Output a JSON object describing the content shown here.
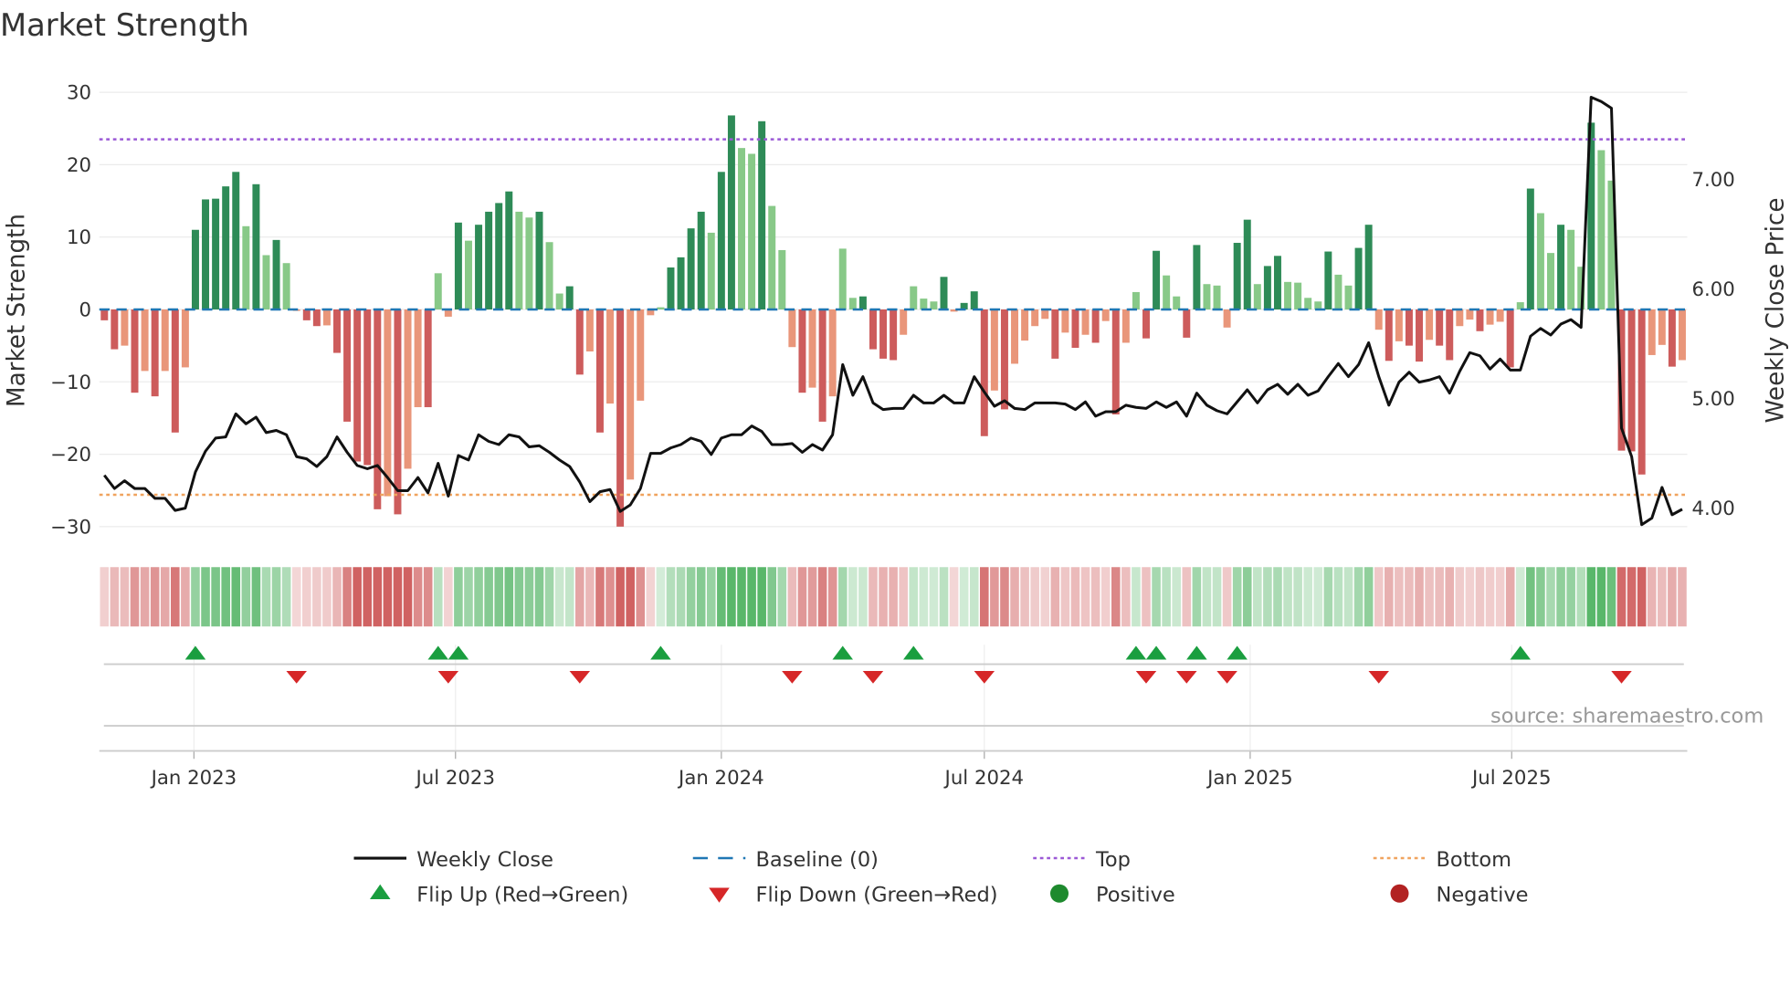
{
  "chart_data": {
    "type": "bar",
    "title": "Market Strength",
    "ylabel": "Market Strength",
    "y2label": "Weekly Close Price",
    "ylim": [
      -32.6,
      32.5
    ],
    "y2lim": [
      3.66,
      7.96
    ],
    "yticks": [
      30,
      20,
      10,
      0,
      -10,
      -20,
      -30
    ],
    "ytick_labels": [
      "30",
      "20",
      "10",
      "0",
      "−10",
      "−20",
      "−30"
    ],
    "y2ticks": [
      7,
      6,
      5,
      4
    ],
    "y2tick_labels": [
      "7.00",
      "6.00",
      "5.00",
      "4.00"
    ],
    "x_start_week": "2022-10-31",
    "xticks": [
      {
        "date": "2023-01-01",
        "label": "Jan 2023"
      },
      {
        "date": "2023-07-01",
        "label": "Jul 2023"
      },
      {
        "date": "2024-01-01",
        "label": "Jan 2024"
      },
      {
        "date": "2024-07-01",
        "label": "Jul 2024"
      },
      {
        "date": "2025-01-01",
        "label": "Jan 2025"
      },
      {
        "date": "2025-07-01",
        "label": "Jul 2025"
      }
    ],
    "top_level": 23.5,
    "bottom_level": -25.6,
    "baseline": 0,
    "strength": [
      -1.5,
      -5.5,
      -5,
      -11.5,
      -8.5,
      -12,
      -8.5,
      -17,
      -8,
      11,
      15.2,
      15.3,
      17,
      19,
      11.5,
      17.3,
      7.5,
      9.6,
      6.4,
      -0.2,
      -1.5,
      -2.3,
      -2.2,
      -6,
      -15.5,
      -21,
      -21.5,
      -27.6,
      -25.8,
      -28.3,
      -22,
      -13.5,
      -13.5,
      5,
      -1,
      12,
      9.5,
      11.7,
      13.5,
      14.7,
      16.3,
      13.5,
      12.7,
      13.5,
      9.3,
      2.2,
      3.2,
      -9,
      -5.8,
      -17,
      -13,
      -30,
      -23.5,
      -12.6,
      -0.8,
      0.3,
      5.8,
      7.2,
      11.2,
      13.5,
      10.6,
      19,
      26.8,
      22.3,
      21.5,
      26,
      14.3,
      8.2,
      -5.2,
      -11.5,
      -10.8,
      -15.5,
      -12,
      8.4,
      1.6,
      1.8,
      -5.5,
      -6.8,
      -7,
      -3.5,
      3.2,
      1.5,
      1.1,
      4.5,
      -0.3,
      0.9,
      2.5,
      -17.5,
      -11.2,
      -13.8,
      -7.5,
      -4.3,
      -2.3,
      -1.3,
      -6.8,
      -3.2,
      -5.3,
      -3.5,
      -4.6,
      -1.6,
      -14.5,
      -4.6,
      2.4,
      -4,
      8.1,
      4.7,
      1.8,
      -3.9,
      8.9,
      3.5,
      3.3,
      -2.5,
      9.2,
      12.4,
      3.5,
      6,
      7.4,
      3.8,
      3.7,
      1.6,
      1.1,
      8,
      4.8,
      3.3,
      8.5,
      11.7,
      -2.8,
      -7.1,
      -4.4,
      -5,
      -7.2,
      -4.2,
      -5,
      -7,
      -2.3,
      -1.4,
      -3,
      -2.1,
      -1.7,
      -8,
      1,
      16.7,
      13.3,
      7.8,
      11.7,
      11,
      5.9,
      25.8,
      22,
      17.8,
      -19.5,
      -19.6,
      -22.8,
      -6.3,
      -4.9,
      -7.9,
      -7
    ],
    "weekly_close": [
      4.3,
      4.18,
      4.25,
      4.18,
      4.18,
      4.09,
      4.09,
      3.98,
      4.0,
      4.33,
      4.52,
      4.64,
      4.65,
      4.86,
      4.77,
      4.83,
      4.69,
      4.71,
      4.67,
      4.47,
      4.45,
      4.38,
      4.47,
      4.65,
      4.51,
      4.39,
      4.36,
      4.39,
      4.28,
      4.16,
      4.16,
      4.28,
      4.14,
      4.41,
      4.11,
      4.48,
      4.44,
      4.67,
      4.61,
      4.58,
      4.67,
      4.65,
      4.56,
      4.57,
      4.51,
      4.44,
      4.38,
      4.24,
      4.06,
      4.15,
      4.17,
      3.97,
      4.03,
      4.18,
      4.5,
      4.5,
      4.55,
      4.58,
      4.64,
      4.61,
      4.49,
      4.64,
      4.67,
      4.67,
      4.75,
      4.7,
      4.58,
      4.58,
      4.59,
      4.51,
      4.58,
      4.53,
      4.67,
      5.31,
      5.03,
      5.2,
      4.96,
      4.9,
      4.91,
      4.91,
      5.03,
      4.96,
      4.96,
      5.03,
      4.96,
      4.96,
      5.2,
      5.06,
      4.93,
      4.98,
      4.91,
      4.9,
      4.96,
      4.96,
      4.96,
      4.95,
      4.9,
      4.97,
      4.84,
      4.88,
      4.88,
      4.94,
      4.92,
      4.91,
      4.97,
      4.92,
      4.97,
      4.84,
      5.05,
      4.94,
      4.89,
      4.86,
      4.97,
      5.08,
      4.96,
      5.08,
      5.13,
      5.04,
      5.13,
      5.03,
      5.07,
      5.2,
      5.32,
      5.2,
      5.31,
      5.51,
      5.2,
      4.94,
      5.15,
      5.24,
      5.15,
      5.17,
      5.2,
      5.05,
      5.25,
      5.42,
      5.39,
      5.27,
      5.36,
      5.26,
      5.26,
      5.57,
      5.64,
      5.58,
      5.68,
      5.72,
      5.65,
      7.75,
      7.71,
      7.65,
      4.73,
      4.47,
      3.85,
      3.91,
      4.19,
      3.94,
      3.99
    ],
    "flip_up_weeks": [
      9,
      33,
      35,
      55,
      73,
      80,
      102,
      104,
      108,
      112,
      140
    ],
    "flip_down_weeks": [
      19,
      34,
      47,
      68,
      76,
      87,
      103,
      107,
      111,
      126,
      150
    ],
    "legend": [
      {
        "label": "Weekly Close",
        "kind": "line"
      },
      {
        "label": "Baseline (0)",
        "kind": "dash"
      },
      {
        "label": "Top",
        "kind": "dot-purple"
      },
      {
        "label": "Bottom",
        "kind": "dot-orange"
      },
      {
        "label": "Flip Up (Red→Green)",
        "kind": "tri-up"
      },
      {
        "label": "Flip Down (Green→Red)",
        "kind": "tri-down"
      },
      {
        "label": "Positive",
        "kind": "dot-green"
      },
      {
        "label": "Negative",
        "kind": "dot-red"
      }
    ],
    "legend_position": "bottom",
    "source": "source: sharemaestro.com",
    "colors": {
      "green_dark": "#2e8b57",
      "green_light": "#88c988",
      "red_dark": "#cd5c5c",
      "red_light": "#e9967a",
      "close": "#111111",
      "baseline": "#1f77b4",
      "top": "#9b59d6",
      "bottom": "#f0a35e",
      "flip_up": "#1a9e3f",
      "flip_down": "#d62728",
      "positive": "#1e8a2e",
      "negative": "#b22222"
    }
  }
}
